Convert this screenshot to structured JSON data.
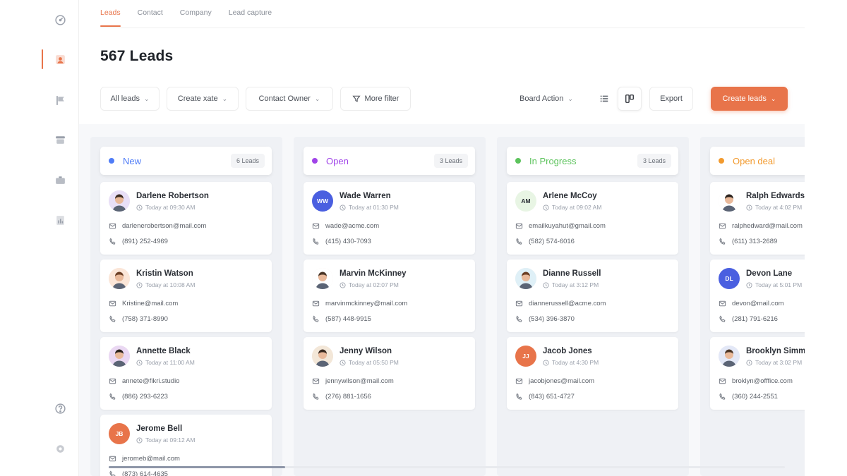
{
  "tabs": [
    "Leads",
    "Contact",
    "Company",
    "Lead capture"
  ],
  "page_title": "567 Leads",
  "toolbar": {
    "all_leads": "All leads",
    "create_date": "Create xate",
    "contact_owner": "Contact Owner",
    "more_filter": "More filter",
    "board_action": "Board Action",
    "export": "Export",
    "create_leads": "Create leads"
  },
  "colors": {
    "accent": "#e8744a",
    "new": "#4f7cf7",
    "open": "#a044e8",
    "in_progress": "#5cc35c",
    "open_deal": "#f29a2e"
  },
  "columns": [
    {
      "title": "New",
      "count": "6 Leads",
      "cards": [
        {
          "name": "Darlene Robertson",
          "time": "Today at 09:30 AM",
          "email": "darlenerobertson@mail.com",
          "phone": "(891) 252-4969"
        },
        {
          "name": "Kristin Watson",
          "time": "Today at 10:08 AM",
          "email": "Kristine@mail.com",
          "phone": "(758) 371-8990"
        },
        {
          "name": "Annette Black",
          "time": "Today at 11:00 AM",
          "email": "annete@fikri.studio",
          "phone": "(886) 293-6223"
        },
        {
          "name": "Jerome Bell",
          "initials": "JB",
          "time": "Today at 09:12 AM",
          "email": "jeromeb@mail.com",
          "phone": "(873) 614-4635"
        }
      ]
    },
    {
      "title": "Open",
      "count": "3 Leads",
      "cards": [
        {
          "name": "Wade Warren",
          "initials": "WW",
          "time": "Today at 01:30 PM",
          "email": "wade@acme.com",
          "phone": "(415) 430-7093"
        },
        {
          "name": "Marvin McKinney",
          "time": "Today at 02:07 PM",
          "email": "marvinmckinney@mail.com",
          "phone": "(587) 448-9915"
        },
        {
          "name": "Jenny Wilson",
          "time": "Today at 05:50 PM",
          "email": "jennywilson@mail.com",
          "phone": "(276) 881-1656"
        }
      ]
    },
    {
      "title": "In Progress",
      "count": "3 Leads",
      "cards": [
        {
          "name": "Arlene McCoy",
          "initials": "AM",
          "time": "Today at 09:02 AM",
          "email": "emailkuyahut@gmail.com",
          "phone": "(582) 574-6016"
        },
        {
          "name": "Dianne Russell",
          "time": "Today at 3:12 PM",
          "email": "diannerussell@acme.com",
          "phone": "(534) 396-3870"
        },
        {
          "name": "Jacob Jones",
          "initials": "JJ",
          "time": "Today at 4:30 PM",
          "email": "jacobjones@mail.com",
          "phone": "(843) 651-4727"
        }
      ]
    },
    {
      "title": "Open deal",
      "count": "",
      "cards": [
        {
          "name": "Ralph Edwards",
          "time": "Today at 4:02 PM",
          "email": "ralphedward@mail.com",
          "phone": "(611) 313-2689"
        },
        {
          "name": "Devon Lane",
          "initials": "DL",
          "time": "Today at 5:01 PM",
          "email": "devon@mail.com",
          "phone": "(281) 791-6216"
        },
        {
          "name": "Brooklyn Simmons",
          "time": "Today at 3:02 PM",
          "email": "broklyn@offfice.com",
          "phone": "(360) 244-2551"
        }
      ]
    }
  ]
}
